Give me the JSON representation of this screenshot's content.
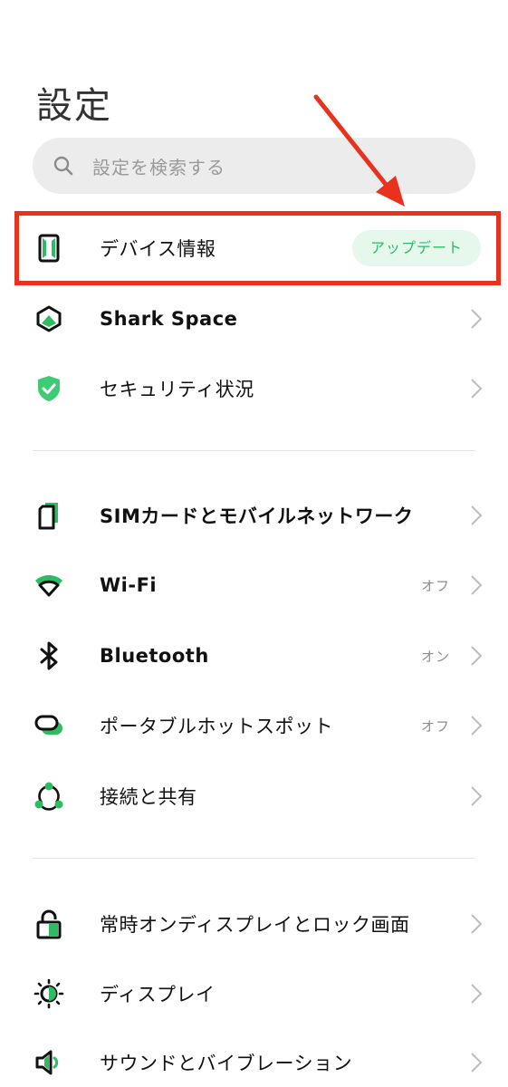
{
  "header": {
    "title": "設定"
  },
  "search": {
    "placeholder": "設定を検索する"
  },
  "colors": {
    "accent": "#2fbb62",
    "highlight": "#e8321e"
  },
  "items": [
    {
      "label": "デバイス情報",
      "badge": "アップデート",
      "icon": "phone-icon"
    },
    {
      "label": "Shark Space",
      "icon": "shark-space-icon"
    },
    {
      "label": "セキュリティ状況",
      "icon": "shield-icon"
    },
    {
      "label": "SIMカードとモバイルネットワーク",
      "icon": "sim-icon"
    },
    {
      "label": "Wi-Fi",
      "status": "オフ",
      "icon": "wifi-icon"
    },
    {
      "label": "Bluetooth",
      "status": "オン",
      "icon": "bluetooth-icon"
    },
    {
      "label": "ポータブルホットスポット",
      "status": "オフ",
      "icon": "hotspot-icon"
    },
    {
      "label": "接続と共有",
      "icon": "connection-share-icon"
    },
    {
      "label": "常時オンディスプレイとロック画面",
      "icon": "lock-icon"
    },
    {
      "label": "ディスプレイ",
      "icon": "brightness-icon"
    },
    {
      "label": "サウンドとバイブレーション",
      "icon": "speaker-icon"
    }
  ]
}
